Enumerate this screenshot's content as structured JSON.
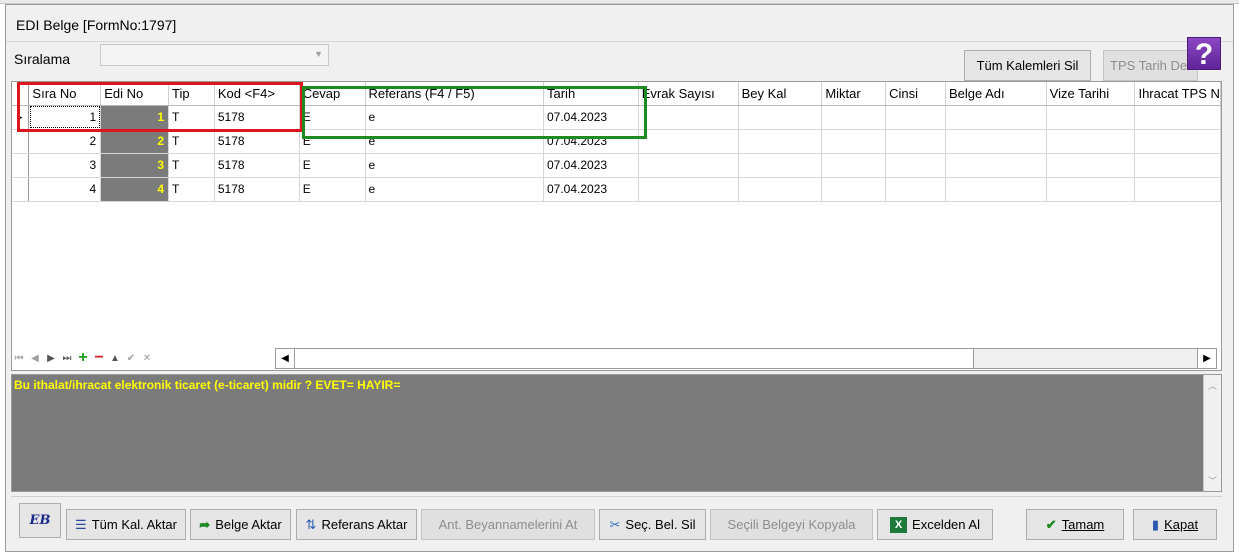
{
  "window": {
    "title": "EDI Belge  [FormNo:1797]"
  },
  "sort": {
    "label": "Sıralama",
    "value": ""
  },
  "top_buttons": {
    "delete_all": "Tüm Kalemleri Sil",
    "tps_date": "TPS Tarih De"
  },
  "grid": {
    "columns": [
      "Sıra No",
      "Edi No",
      "Tip",
      "Kod <F4>",
      "Cevap",
      "Referans (F4 / F5)",
      "Tarih",
      "Evrak Sayısı",
      "Bey Kal",
      "Miktar",
      "Cinsi",
      "Belge Adı",
      "Vize Tarihi",
      "Ihracat TPS N"
    ],
    "rows": [
      {
        "sira_no": "1",
        "edi_no": "1",
        "tip": "T",
        "kod": "5178",
        "cevap": "E",
        "referans": "e",
        "tarih": "07.04.2023"
      },
      {
        "sira_no": "2",
        "edi_no": "2",
        "tip": "T",
        "kod": "5178",
        "cevap": "E",
        "referans": "e",
        "tarih": "07.04.2023"
      },
      {
        "sira_no": "3",
        "edi_no": "3",
        "tip": "T",
        "kod": "5178",
        "cevap": "E",
        "referans": "e",
        "tarih": "07.04.2023"
      },
      {
        "sira_no": "4",
        "edi_no": "4",
        "tip": "T",
        "kod": "5178",
        "cevap": "E",
        "referans": "e",
        "tarih": "07.04.2023"
      }
    ]
  },
  "memo": {
    "text": "Bu ithalat/ihracat elektronik ticaret (e-ticaret) midir ? EVET= HAYIR="
  },
  "bottom_buttons": {
    "logo": "EB",
    "all_items_transfer": "Tüm Kal. Aktar",
    "doc_transfer": "Belge Aktar",
    "ref_transfer": "Referans Aktar",
    "ant_decl": "Ant. Beyannamelerini At",
    "del_selected": "Seç. Bel. Sil",
    "copy_selected": "Seçili Belgeyi Kopyala",
    "from_excel": "Excelden Al",
    "ok": "Tamam",
    "close": "Kapat"
  },
  "icons": {
    "help": "help-question-icon",
    "list": "list-icon",
    "arrow": "green-arrow-icon",
    "transfer": "transfer-icon",
    "delete": "delete-icon",
    "excel": "excel-icon",
    "check": "check-icon",
    "close": "exit-door-icon"
  },
  "colors": {
    "edi_cell_bg": "#7b7b7b",
    "edi_cell_text": "#ffff00",
    "memo_bg": "#7b7b7b",
    "highlight_red": "#e0141e",
    "highlight_green": "#1f8a1f"
  }
}
